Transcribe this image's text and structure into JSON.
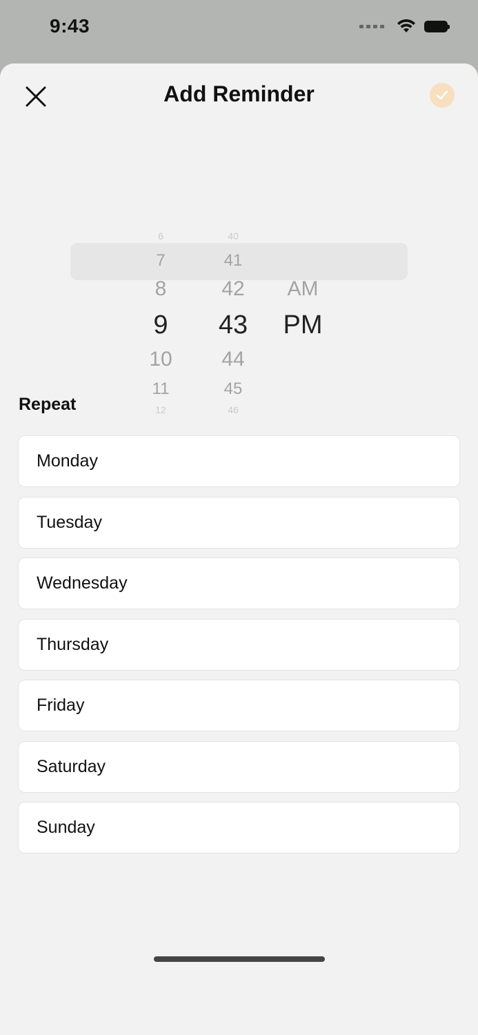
{
  "status_bar": {
    "time": "9:43"
  },
  "header": {
    "title": "Add Reminder"
  },
  "picker": {
    "hours": [
      "6",
      "7",
      "8",
      "9",
      "10",
      "11",
      "12"
    ],
    "minutes": [
      "40",
      "41",
      "42",
      "43",
      "44",
      "45",
      "46"
    ],
    "periods": [
      "AM",
      "PM"
    ],
    "selected": {
      "hour": "9",
      "minute": "43",
      "period": "PM"
    }
  },
  "repeat": {
    "label": "Repeat",
    "days": [
      "Monday",
      "Tuesday",
      "Wednesday",
      "Thursday",
      "Friday",
      "Saturday",
      "Sunday"
    ]
  },
  "colors": {
    "confirm_accent": "#f7dfc0",
    "sheet_bg": "#f2f2f2",
    "backdrop": "#b3b5b2"
  }
}
